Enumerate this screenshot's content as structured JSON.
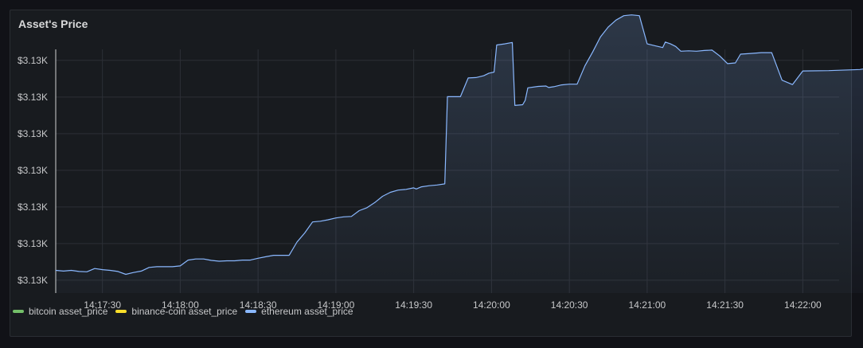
{
  "panel": {
    "title": "Asset's Price"
  },
  "colors": {
    "background": "#111217",
    "panel": "#181b1f",
    "grid": "#2c2f36",
    "text": "#c7c8ca",
    "bitcoin": "#73bf69",
    "binance": "#fade2a",
    "ethereum": "#8ab8ff"
  },
  "chart_data": {
    "type": "area",
    "title": "Asset's Price",
    "xlabel": "",
    "ylabel": "",
    "y_tick_labels": [
      "$3.13K",
      "$3.13K",
      "$3.13K",
      "$3.13K",
      "$3.13K",
      "$3.13K",
      "$3.13K"
    ],
    "y_ticks": [
      1,
      2,
      3,
      4,
      5,
      6,
      7
    ],
    "ylim": [
      0.65,
      7.3
    ],
    "x_tick_labels": [
      "14:17:30",
      "14:18:00",
      "14:18:30",
      "14:19:00",
      "14:19:30",
      "14:20:00",
      "14:20:30",
      "14:21:00",
      "14:21:30",
      "14:22:00"
    ],
    "xlim": [
      "14:17:12",
      "14:22:14"
    ],
    "grid": true,
    "legend_placement": "bottom-left",
    "series": [
      {
        "name": "bitcoin asset_price",
        "color": "#73bf69",
        "points": []
      },
      {
        "name": "binance-coin asset_price",
        "color": "#fade2a",
        "points": []
      },
      {
        "name": "ethereum asset_price",
        "color": "#8ab8ff",
        "points": [
          [
            "14:17:12",
            1.27
          ],
          [
            "14:17:15",
            1.25
          ],
          [
            "14:17:18",
            1.27
          ],
          [
            "14:17:21",
            1.24
          ],
          [
            "14:17:24",
            1.23
          ],
          [
            "14:17:27",
            1.32
          ],
          [
            "14:17:30",
            1.29
          ],
          [
            "14:17:33",
            1.27
          ],
          [
            "14:17:36",
            1.24
          ],
          [
            "14:17:39",
            1.16
          ],
          [
            "14:17:42",
            1.21
          ],
          [
            "14:17:45",
            1.25
          ],
          [
            "14:17:48",
            1.35
          ],
          [
            "14:17:51",
            1.37
          ],
          [
            "14:17:54",
            1.37
          ],
          [
            "14:17:57",
            1.37
          ],
          [
            "14:18:00",
            1.39
          ],
          [
            "14:18:03",
            1.55
          ],
          [
            "14:18:06",
            1.58
          ],
          [
            "14:18:09",
            1.58
          ],
          [
            "14:18:12",
            1.54
          ],
          [
            "14:18:15",
            1.52
          ],
          [
            "14:18:18",
            1.53
          ],
          [
            "14:18:21",
            1.53
          ],
          [
            "14:18:24",
            1.55
          ],
          [
            "14:18:27",
            1.55
          ],
          [
            "14:18:30",
            1.6
          ],
          [
            "14:18:33",
            1.64
          ],
          [
            "14:18:36",
            1.68
          ],
          [
            "14:18:39",
            1.68
          ],
          [
            "14:18:42",
            1.68
          ],
          [
            "14:18:45",
            2.04
          ],
          [
            "14:18:48",
            2.29
          ],
          [
            "14:18:51",
            2.59
          ],
          [
            "14:18:54",
            2.61
          ],
          [
            "14:18:57",
            2.65
          ],
          [
            "14:19:00",
            2.7
          ],
          [
            "14:19:03",
            2.73
          ],
          [
            "14:19:06",
            2.74
          ],
          [
            "14:19:09",
            2.9
          ],
          [
            "14:19:12",
            2.98
          ],
          [
            "14:19:15",
            3.12
          ],
          [
            "14:19:18",
            3.29
          ],
          [
            "14:19:21",
            3.4
          ],
          [
            "14:19:24",
            3.46
          ],
          [
            "14:19:27",
            3.48
          ],
          [
            "14:19:30",
            3.52
          ],
          [
            "14:19:31",
            3.49
          ],
          [
            "14:19:33",
            3.55
          ],
          [
            "14:19:36",
            3.58
          ],
          [
            "14:19:39",
            3.6
          ],
          [
            "14:19:42",
            3.63
          ],
          [
            "14:19:43",
            6.01
          ],
          [
            "14:19:45",
            6.01
          ],
          [
            "14:19:48",
            6.01
          ],
          [
            "14:19:51",
            6.52
          ],
          [
            "14:19:54",
            6.53
          ],
          [
            "14:19:57",
            6.58
          ],
          [
            "14:19:59",
            6.65
          ],
          [
            "14:20:01",
            6.68
          ],
          [
            "14:20:02",
            7.42
          ],
          [
            "14:20:05",
            7.45
          ],
          [
            "14:20:08",
            7.49
          ],
          [
            "14:20:09",
            5.77
          ],
          [
            "14:20:12",
            5.79
          ],
          [
            "14:20:13",
            5.91
          ],
          [
            "14:20:14",
            6.25
          ],
          [
            "14:20:18",
            6.29
          ],
          [
            "14:20:21",
            6.3
          ],
          [
            "14:20:22",
            6.26
          ],
          [
            "14:20:24",
            6.28
          ],
          [
            "14:20:27",
            6.33
          ],
          [
            "14:20:30",
            6.35
          ],
          [
            "14:20:33",
            6.35
          ],
          [
            "14:20:36",
            6.85
          ],
          [
            "14:20:39",
            7.23
          ],
          [
            "14:20:42",
            7.64
          ],
          [
            "14:20:45",
            7.91
          ],
          [
            "14:20:48",
            8.1
          ],
          [
            "14:20:51",
            8.22
          ],
          [
            "14:20:54",
            8.24
          ],
          [
            "14:20:57",
            8.22
          ],
          [
            "14:21:00",
            7.45
          ],
          [
            "14:21:03",
            7.4
          ],
          [
            "14:21:06",
            7.35
          ],
          [
            "14:21:07",
            7.5
          ],
          [
            "14:21:09",
            7.45
          ],
          [
            "14:21:11",
            7.38
          ],
          [
            "14:21:13",
            7.25
          ],
          [
            "14:21:16",
            7.26
          ],
          [
            "14:21:19",
            7.25
          ],
          [
            "14:21:22",
            7.27
          ],
          [
            "14:21:25",
            7.28
          ],
          [
            "14:21:28",
            7.12
          ],
          [
            "14:21:31",
            6.91
          ],
          [
            "14:21:34",
            6.93
          ],
          [
            "14:21:36",
            7.17
          ],
          [
            "14:21:40",
            7.19
          ],
          [
            "14:21:44",
            7.21
          ],
          [
            "14:21:48",
            7.21
          ],
          [
            "14:21:52",
            6.46
          ],
          [
            "14:21:56",
            6.34
          ],
          [
            "14:22:00",
            6.71
          ],
          [
            "14:22:10",
            6.72
          ],
          [
            "14:22:22",
            6.75
          ],
          [
            "14:22:31",
            6.85
          ],
          [
            "14:22:39",
            6.96
          ],
          [
            "14:22:46",
            7.02
          ],
          [
            "14:22:49",
            7.1
          ],
          [
            "14:22:53",
            7.24
          ],
          [
            "14:22:56",
            7.39
          ],
          [
            "14:22:59",
            7.54
          ]
        ]
      }
    ]
  }
}
